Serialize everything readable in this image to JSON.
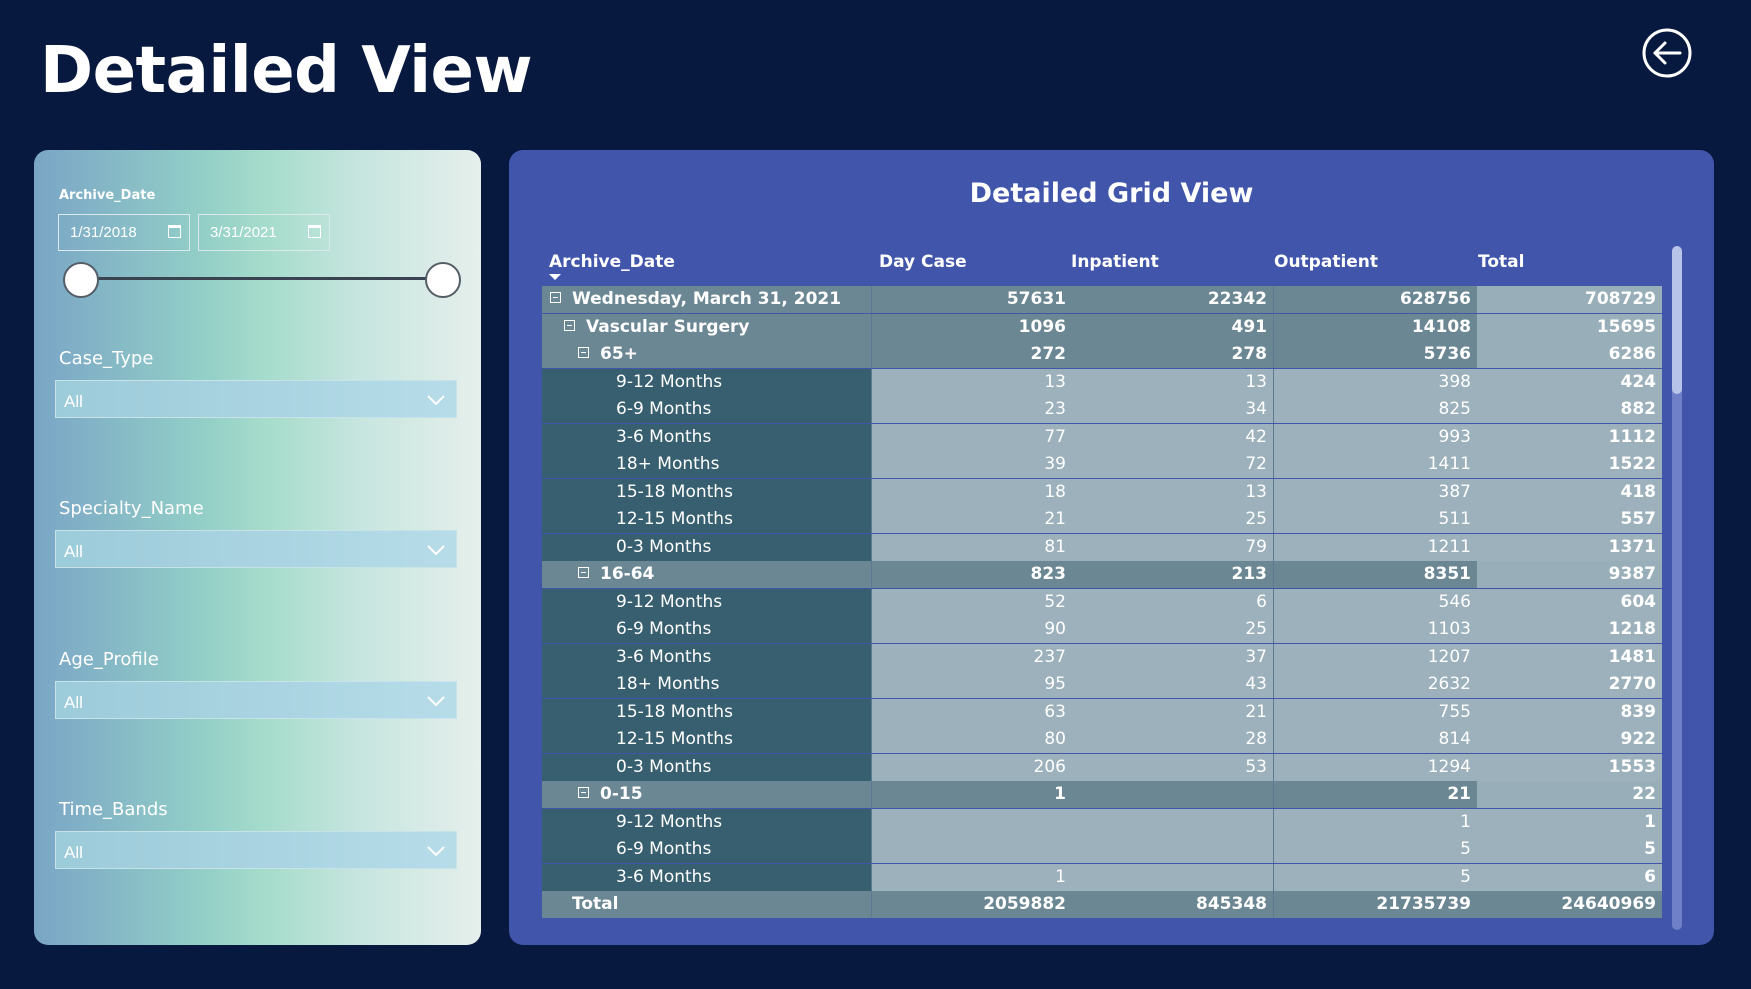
{
  "page": {
    "title": "Detailed View"
  },
  "filters": {
    "archive_date": {
      "label": "Archive_Date",
      "start": "1/31/2018",
      "end": "3/31/2021"
    },
    "case_type": {
      "label": "Case_Type",
      "value": "All"
    },
    "specialty_name": {
      "label": "Specialty_Name",
      "value": "All"
    },
    "age_profile": {
      "label": "Age_Profile",
      "value": "All"
    },
    "time_bands": {
      "label": "Time_Bands",
      "value": "All"
    }
  },
  "grid": {
    "title": "Detailed Grid View",
    "columns": [
      "Archive_Date",
      "Day Case",
      "Inpatient",
      "Outpatient",
      "Total"
    ],
    "rows": [
      {
        "level": "date",
        "name": "Wednesday, March 31, 2021",
        "day_case": "57631",
        "inpatient": "22342",
        "outpatient": "628756",
        "total": "708729"
      },
      {
        "level": "spec",
        "name": "Vascular Surgery",
        "day_case": "1096",
        "inpatient": "491",
        "outpatient": "14108",
        "total": "15695"
      },
      {
        "level": "age",
        "name": "65+",
        "day_case": "272",
        "inpatient": "278",
        "outpatient": "5736",
        "total": "6286"
      },
      {
        "level": "band",
        "name": "9-12 Months",
        "day_case": "13",
        "inpatient": "13",
        "outpatient": "398",
        "total": "424"
      },
      {
        "level": "band",
        "name": "6-9 Months",
        "day_case": "23",
        "inpatient": "34",
        "outpatient": "825",
        "total": "882"
      },
      {
        "level": "band",
        "name": "3-6 Months",
        "day_case": "77",
        "inpatient": "42",
        "outpatient": "993",
        "total": "1112"
      },
      {
        "level": "band",
        "name": "18+ Months",
        "day_case": "39",
        "inpatient": "72",
        "outpatient": "1411",
        "total": "1522"
      },
      {
        "level": "band",
        "name": "15-18 Months",
        "day_case": "18",
        "inpatient": "13",
        "outpatient": "387",
        "total": "418"
      },
      {
        "level": "band",
        "name": "12-15 Months",
        "day_case": "21",
        "inpatient": "25",
        "outpatient": "511",
        "total": "557"
      },
      {
        "level": "band",
        "name": "0-3 Months",
        "day_case": "81",
        "inpatient": "79",
        "outpatient": "1211",
        "total": "1371"
      },
      {
        "level": "age",
        "name": "16-64",
        "day_case": "823",
        "inpatient": "213",
        "outpatient": "8351",
        "total": "9387"
      },
      {
        "level": "band",
        "name": "9-12 Months",
        "day_case": "52",
        "inpatient": "6",
        "outpatient": "546",
        "total": "604"
      },
      {
        "level": "band",
        "name": "6-9 Months",
        "day_case": "90",
        "inpatient": "25",
        "outpatient": "1103",
        "total": "1218"
      },
      {
        "level": "band",
        "name": "3-6 Months",
        "day_case": "237",
        "inpatient": "37",
        "outpatient": "1207",
        "total": "1481"
      },
      {
        "level": "band",
        "name": "18+ Months",
        "day_case": "95",
        "inpatient": "43",
        "outpatient": "2632",
        "total": "2770"
      },
      {
        "level": "band",
        "name": "15-18 Months",
        "day_case": "63",
        "inpatient": "21",
        "outpatient": "755",
        "total": "839"
      },
      {
        "level": "band",
        "name": "12-15 Months",
        "day_case": "80",
        "inpatient": "28",
        "outpatient": "814",
        "total": "922"
      },
      {
        "level": "band",
        "name": "0-3 Months",
        "day_case": "206",
        "inpatient": "53",
        "outpatient": "1294",
        "total": "1553"
      },
      {
        "level": "age",
        "name": "0-15",
        "day_case": "1",
        "inpatient": "",
        "outpatient": "21",
        "total": "22"
      },
      {
        "level": "band",
        "name": "9-12 Months",
        "day_case": "",
        "inpatient": "",
        "outpatient": "1",
        "total": "1"
      },
      {
        "level": "band",
        "name": "6-9 Months",
        "day_case": "",
        "inpatient": "",
        "outpatient": "5",
        "total": "5"
      },
      {
        "level": "band",
        "name": "3-6 Months",
        "day_case": "1",
        "inpatient": "",
        "outpatient": "5",
        "total": "6"
      },
      {
        "level": "total",
        "name": "Total",
        "day_case": "2059882",
        "inpatient": "845348",
        "outpatient": "21735739",
        "total": "24640969"
      }
    ]
  },
  "colors": {
    "background": "#08193f",
    "grid_panel": "#4156ab",
    "row_label_band": "#375f6f",
    "subtotal_row": "#6b8793",
    "value_cell": "#9cb1bb"
  },
  "icons": {
    "back": "back-arrow-circle-icon",
    "calendar": "calendar-icon",
    "chevron": "chevron-down-icon",
    "expand": "collapse-minus-icon"
  }
}
